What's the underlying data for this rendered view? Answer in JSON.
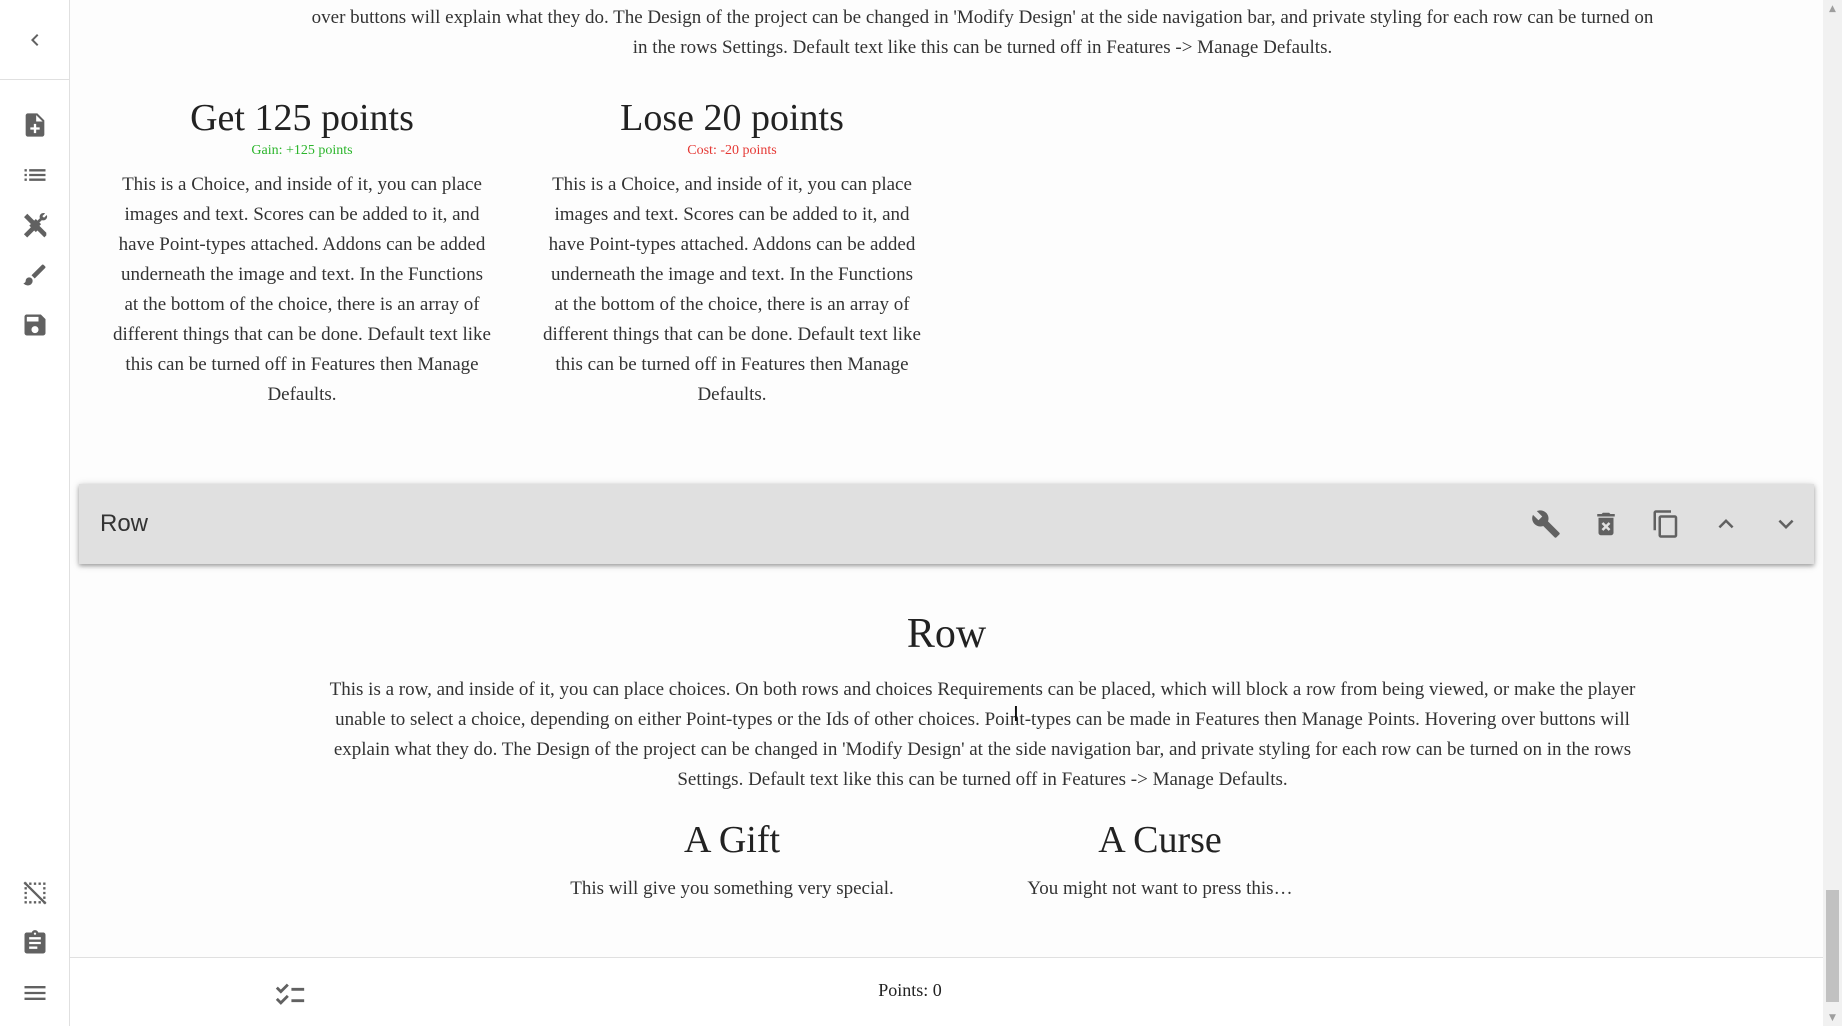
{
  "top_description": "or make the player unable to select a choice, depending on either Point-types or the Ids of other choices. Point-types can be made in Features then Manage Points. Hovering over buttons will explain what they do. The Design of the project can be changed in 'Modify Design' at the side navigation bar, and private styling for each row can be turned on in the rows Settings. Default text like this can be turned off in Features -> Manage Defaults.",
  "choices_top": [
    {
      "title": "Get 125 points",
      "score": "Gain: +125  points",
      "text": "This is a Choice, and inside of it, you can place images and text. Scores can be added to it, and have Point-types attached. Addons can be added underneath the image and text. In the Functions at the bottom of the choice, there is an array of different things that can be done. Default text like this can be turned off in Features then Manage Defaults."
    },
    {
      "title": "Lose 20 points",
      "score": "Cost: -20  points",
      "text": "This is a Choice, and inside of it, you can place images and text. Scores can be added to it, and have Point-types attached. Addons can be added underneath the image and text. In the Functions at the bottom of the choice, there is an array of different things that can be done. Default text like this can be turned off in Features then Manage Defaults."
    }
  ],
  "row_bar": {
    "label": "Row"
  },
  "row": {
    "title": "Row",
    "description": "This is a row, and inside of it, you can place choices. On both rows and choices Requirements can be placed, which will block a row from being viewed, or make the player unable to select a choice, depending on either Point-types or the Ids of other choices. Point-types can be made in Features then Manage Points. Hovering over buttons will explain what they do. The Design of the project can be changed in 'Modify Design' at the side navigation bar, and private styling for each row can be turned on in the rows Settings. Default text like this can be turned off in Features -> Manage Defaults."
  },
  "choices_bottom": [
    {
      "title": "A Gift",
      "text": "This will give you something very special."
    },
    {
      "title": "A Curse",
      "text": "You might not want to press this…"
    }
  ],
  "points_bar": {
    "points_text": "Points: 0"
  },
  "colors": {
    "gain": "#2bb52b",
    "cost": "#e53935",
    "row_bar_bg": "#e0e0e0",
    "icon": "#616161"
  }
}
